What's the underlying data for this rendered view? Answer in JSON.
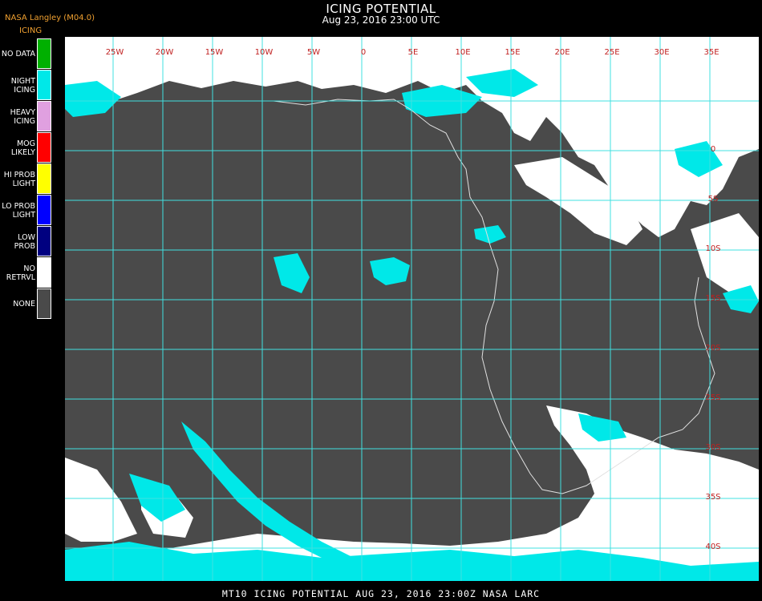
{
  "header": {
    "product_tag": "NASA Langley (M04.0)",
    "title": "ICING POTENTIAL",
    "subtitle": "Aug 23, 2016 23:00 UTC",
    "legend_heading": "ICING"
  },
  "legend": [
    {
      "lines": [
        "NO DATA"
      ],
      "color": "#00b000"
    },
    {
      "lines": [
        "NIGHT",
        "ICING"
      ],
      "color": "#00e8e8"
    },
    {
      "lines": [
        "HEAVY",
        "ICING"
      ],
      "color": "#e0a0e0"
    },
    {
      "lines": [
        "MOG",
        "LIKELY"
      ],
      "color": "#ff0000"
    },
    {
      "lines": [
        "HI PROB",
        "LIGHT"
      ],
      "color": "#ffff00"
    },
    {
      "lines": [
        "LO PROB",
        "LIGHT"
      ],
      "color": "#0000ff"
    },
    {
      "lines": [
        "LOW",
        "PROB"
      ],
      "color": "#000080"
    },
    {
      "lines": [
        "NO",
        "RETRVL"
      ],
      "color": "#ffffff"
    },
    {
      "lines": [
        "NONE"
      ],
      "color": "#4a4a4a"
    }
  ],
  "map": {
    "grid_color": "#40e0e0",
    "label_color": "#c02020",
    "background_color": "#4a4a4a",
    "lon_labels": [
      "25W",
      "20W",
      "15W",
      "10W",
      "5W",
      "0",
      "5E",
      "10E",
      "15E",
      "20E",
      "25E",
      "30E",
      "35E"
    ],
    "lat_labels": [
      "0",
      "5S",
      "10S",
      "15S",
      "20S",
      "25S",
      "30S",
      "35S",
      "40S"
    ]
  },
  "footer": {
    "text": "MT10  ICING POTENTIAL   AUG 23, 2016 23:00Z   NASA LARC"
  }
}
